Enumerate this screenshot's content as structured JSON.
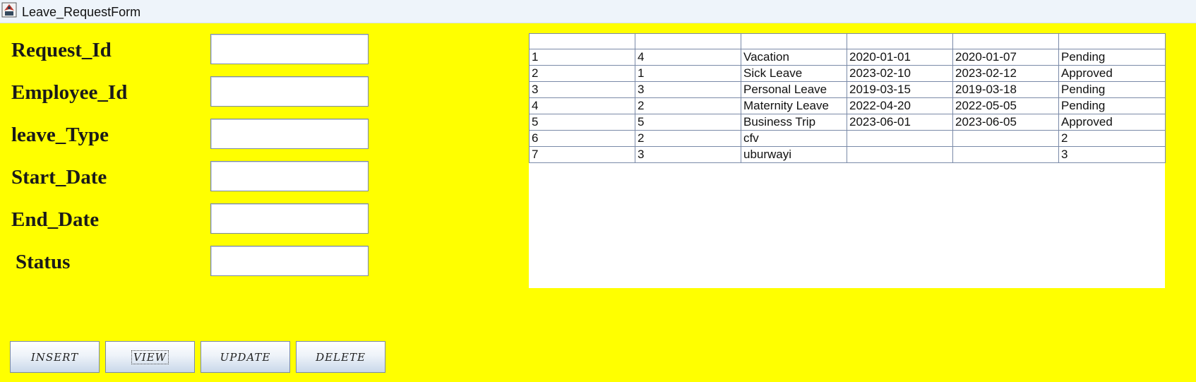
{
  "window": {
    "title": "Leave_RequestForm"
  },
  "form": {
    "fields": [
      {
        "label": "Request_Id",
        "value": ""
      },
      {
        "label": "Employee_Id",
        "value": ""
      },
      {
        "label": "leave_Type",
        "value": ""
      },
      {
        "label": "Start_Date",
        "value": ""
      },
      {
        "label": "End_Date",
        "value": ""
      },
      {
        "label": "Status",
        "value": ""
      }
    ]
  },
  "buttons": {
    "insert": "INSERT",
    "view": "VIEW",
    "update": "UPDATE",
    "delete": "DELETE"
  },
  "table": {
    "headers": [
      "",
      "",
      "",
      "",
      "",
      ""
    ],
    "rows": [
      [
        "1",
        "4",
        "Vacation",
        "2020-01-01",
        "2020-01-07",
        "Pending"
      ],
      [
        "2",
        "1",
        "Sick Leave",
        "2023-02-10",
        "2023-02-12",
        "Approved"
      ],
      [
        "3",
        "3",
        "Personal Leave",
        "2019-03-15",
        "2019-03-18",
        "Pending"
      ],
      [
        "4",
        "2",
        "Maternity Leave",
        "2022-04-20",
        "2022-05-05",
        "Pending"
      ],
      [
        "5",
        "5",
        "Business Trip",
        "2023-06-01",
        "2023-06-05",
        "Approved"
      ],
      [
        "6",
        "2",
        "cfv",
        "",
        "",
        "2"
      ],
      [
        "7",
        "3",
        "uburwayi",
        "",
        "",
        "3"
      ]
    ]
  },
  "colors": {
    "background": "#ffff00",
    "titlebar": "#eef4fa",
    "grid": "#7a8aa8"
  },
  "icons": {
    "app": "java-app-icon"
  }
}
